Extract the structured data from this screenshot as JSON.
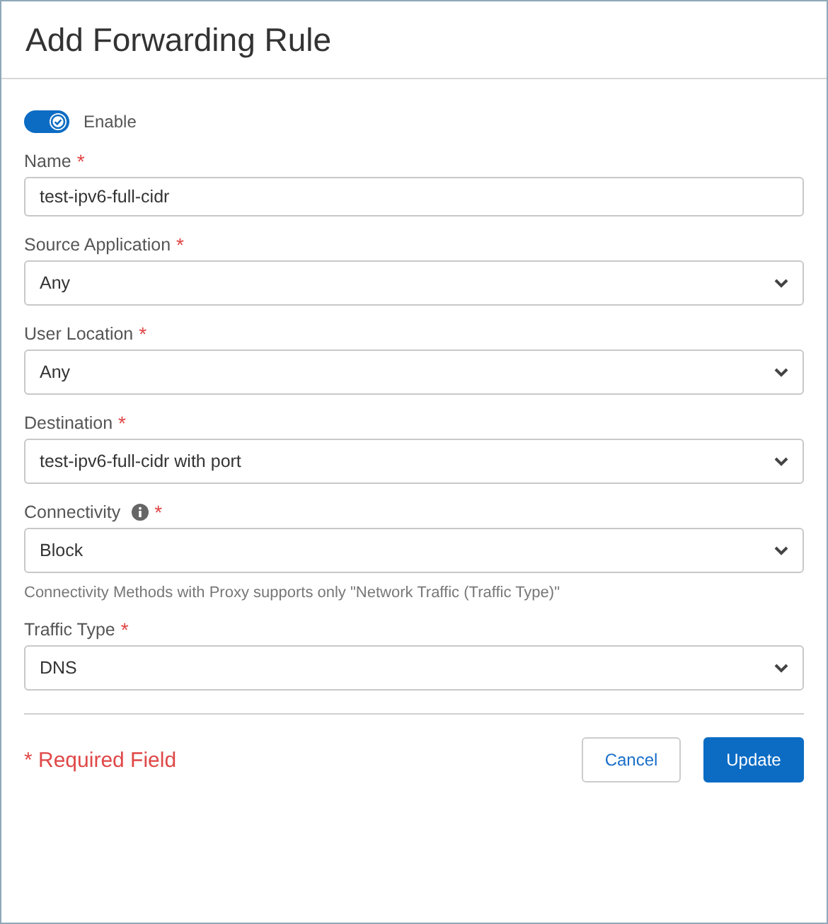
{
  "dialog": {
    "title": "Add Forwarding Rule"
  },
  "enable": {
    "label": "Enable",
    "on": true
  },
  "required_mark": "*",
  "fields": [
    {
      "kind": "text",
      "label": "Name",
      "required": true,
      "info": false,
      "value": "test-ipv6-full-cidr"
    },
    {
      "kind": "select",
      "label": "Source Application",
      "required": true,
      "info": false,
      "value": "Any"
    },
    {
      "kind": "select",
      "label": "User Location",
      "required": true,
      "info": false,
      "value": "Any"
    },
    {
      "kind": "select",
      "label": "Destination",
      "required": true,
      "info": false,
      "value": "test-ipv6-full-cidr with port"
    },
    {
      "kind": "select",
      "label": "Connectivity",
      "required": true,
      "info": true,
      "value": "Block",
      "hint": "Connectivity Methods with Proxy supports only \"Network Traffic (Traffic Type)\""
    },
    {
      "kind": "select",
      "label": "Traffic Type",
      "required": true,
      "info": false,
      "value": "DNS"
    }
  ],
  "footer": {
    "note": "* Required Field",
    "buttons": [
      {
        "kind": "secondary",
        "label": "Cancel"
      },
      {
        "kind": "primary",
        "label": "Update"
      }
    ]
  }
}
